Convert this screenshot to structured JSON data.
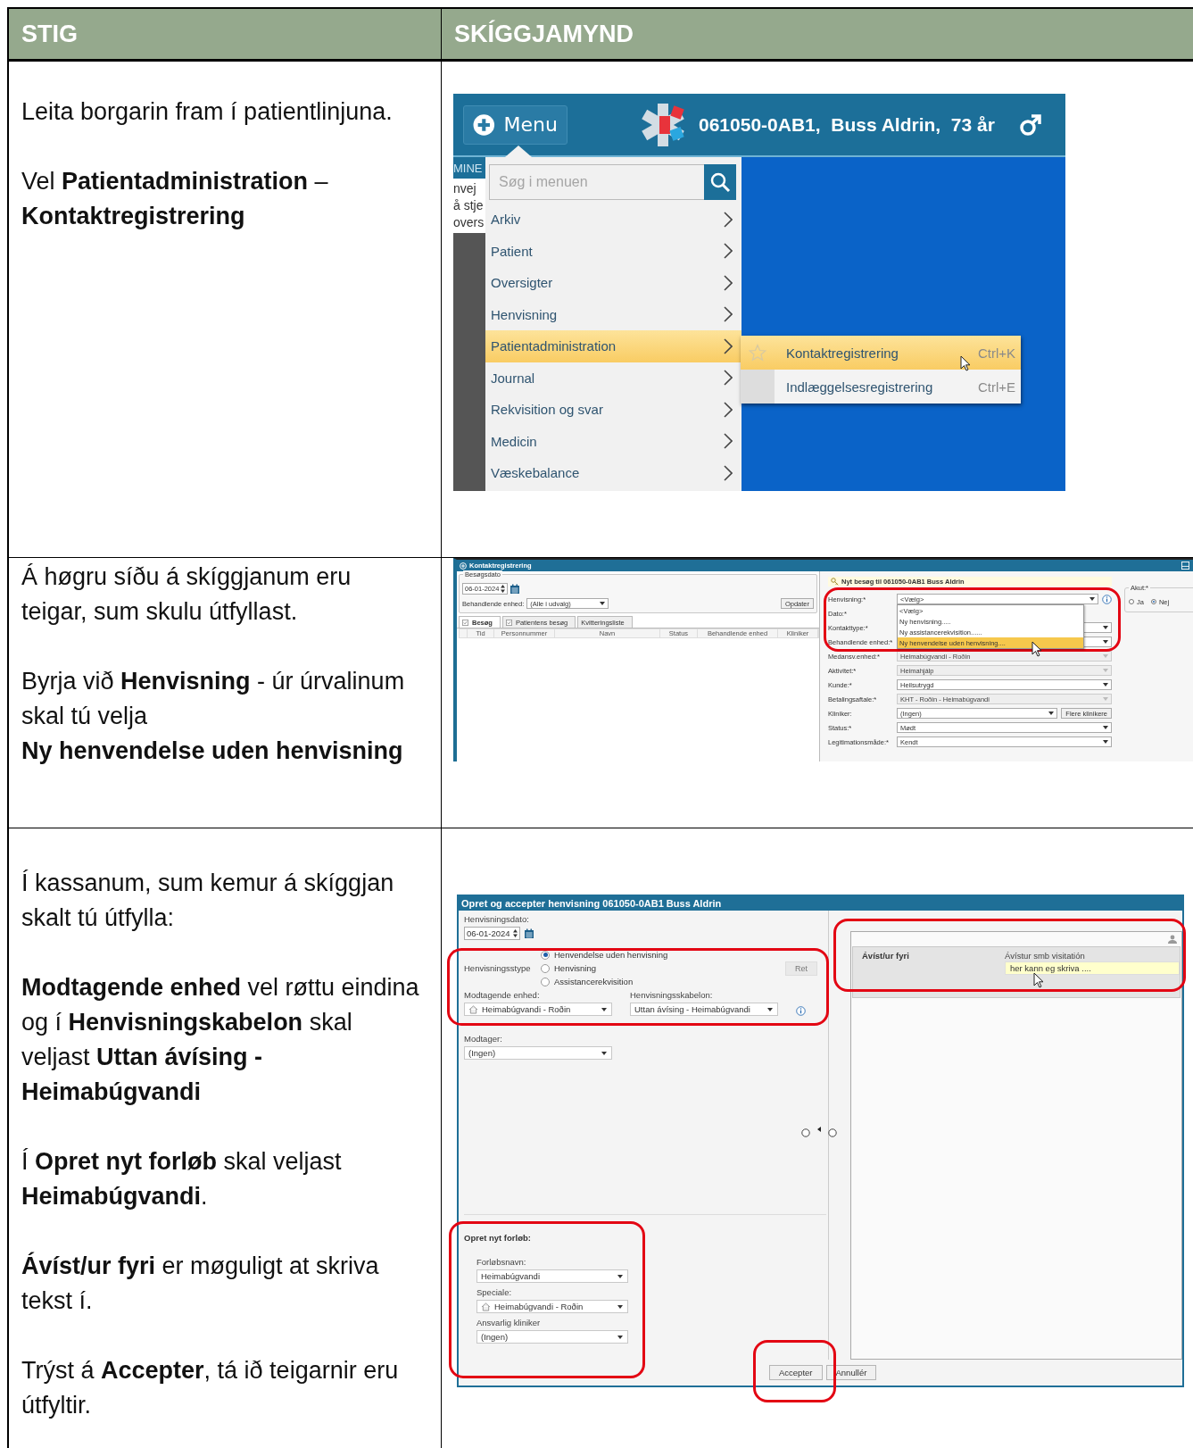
{
  "table": {
    "columns": [
      "STIG",
      "SKÍGGJAMYND"
    ],
    "rows": [
      {
        "text": [
          "Leita borgarin fram í patientlinjuna.",
          "Vel **Patientadministration** – **Kontaktregistrering**"
        ],
        "screenshot": {
          "kind": "menu",
          "menu_button": "Menu",
          "patient": "061050-0AB1,  Buss Aldrin,  73 år",
          "side_tab": "MINE",
          "side_lines": [
            "nvej",
            "å stje",
            "overs"
          ],
          "search": {
            "placeholder": "Søg i menuen"
          },
          "items": [
            {
              "label": "Arkiv",
              "selected": false
            },
            {
              "label": "Patient",
              "selected": false
            },
            {
              "label": "Oversigter",
              "selected": false
            },
            {
              "label": "Henvisning",
              "selected": false
            },
            {
              "label": "Patientadministration",
              "selected": true
            },
            {
              "label": "Journal",
              "selected": false
            },
            {
              "label": "Rekvisition og svar",
              "selected": false
            },
            {
              "label": "Medicin",
              "selected": false
            },
            {
              "label": "Væskebalance",
              "selected": false
            }
          ],
          "submenu": [
            {
              "label": "Kontaktregistrering",
              "shortcut": "Ctrl+K",
              "selected": true
            },
            {
              "label": "Indlæggelsesregistrering",
              "shortcut": "Ctrl+E",
              "selected": false
            }
          ]
        }
      },
      {
        "text": [
          "Á høgru síðu á skíggjanum eru teigar, sum skulu útfyllast.",
          "Byrja við **Henvisning** - úr úrvalinum skal tú velja\n**Ny henvendelse uden henvisning**"
        ],
        "screenshot": {
          "kind": "registration",
          "title": "Kontaktregistrering",
          "visit_date": {
            "legend": "Besøgsdato",
            "value": "06-01-2024"
          },
          "unit": {
            "label": "Behandlende enhed:",
            "value": "(Alle i udvalg)"
          },
          "update_button": "Opdater",
          "tabs": [
            {
              "label": "Besøg",
              "kind": "check",
              "selected": true
            },
            {
              "label": "Patientens besøg",
              "kind": "check",
              "selected": false
            },
            {
              "label": "Kvitteringsliste",
              "kind": "plain",
              "selected": false
            }
          ],
          "columns": [
            "Tid",
            "Personnummer",
            "Navn",
            "Status",
            "Behandlende enhed",
            "Kliniker"
          ],
          "form_title": "Nyt besøg til 061050-0AB1 Buss Aldrin",
          "fields": [
            {
              "kind": "dropdown-info",
              "label": "Henvisning:*",
              "value": "<Vælg>",
              "disabled": false
            },
            {
              "kind": "covered",
              "label": "Dato:*"
            },
            {
              "kind": "covered-dropdown",
              "label": "Kontakttype:*"
            },
            {
              "kind": "covered-dropdown",
              "label": "Behandlende enhed:*"
            },
            {
              "kind": "dropdown",
              "label": "Medansv.enhed:*",
              "value": "Heimabúgvandi - Roðin",
              "disabled": true
            },
            {
              "kind": "dropdown",
              "label": "Aktivitet:*",
              "value": "Heimahjálp",
              "disabled": true
            },
            {
              "kind": "dropdown",
              "label": "Kunde:*",
              "value": "Heilsutrygd",
              "disabled": false
            },
            {
              "kind": "dropdown",
              "label": "Betalingsaftale:*",
              "value": "KHT - Roðin - Heimabúgvandi",
              "disabled": true
            },
            {
              "kind": "dropdown-button",
              "label": "Kliniker:",
              "value": "(Ingen)",
              "disabled": false,
              "button": "Flere klinikere"
            },
            {
              "kind": "dropdown",
              "label": "Status:*",
              "value": "Mødt",
              "disabled": false
            },
            {
              "kind": "dropdown",
              "label": "Legitimationsmåde:*",
              "value": "Kendt",
              "disabled": false
            }
          ],
          "dropdown_options": [
            {
              "label": "<Vælg>",
              "selected": false
            },
            {
              "label": "Ny henvisning.....",
              "selected": false
            },
            {
              "label": "Ny assistancerekvisition......",
              "selected": false
            },
            {
              "label": "Ny henvendelse uden henvisning....",
              "selected": true
            }
          ],
          "akut": {
            "legend": "Akut:*",
            "options": [
              {
                "label": "Ja",
                "selected": false
              },
              {
                "label": "Nej",
                "selected": true
              }
            ]
          }
        }
      },
      {
        "text": [
          "Í kassanum, sum kemur á skíggjan skalt tú útfylla:",
          "**Modtagende enhed** vel røttu eindina og í **Henvisningskabelon** skal veljast **Uttan ávísing - Heimabúgvandi**",
          "Í **Opret nyt forløb** skal veljast **Heimabúgvandi**.",
          "**Ávíst/ur fyri** er møguligt at skriva tekst í.",
          "Trýst á **Accepter**, tá ið teigarnir eru útfyltir."
        ],
        "screenshot": {
          "kind": "referral",
          "title": "Opret og accepter henvisning 061050-0AB1 Buss Aldrin",
          "date": {
            "label": "Henvisningsdato:",
            "value": "06-01-2024"
          },
          "type": {
            "label": "Henvisningsstype",
            "options": [
              {
                "label": "Henvendelse uden henvisning",
                "selected": true
              },
              {
                "label": "Henvisning",
                "selected": false
              },
              {
                "label": "Assistancerekvisition",
                "selected": false
              }
            ]
          },
          "edit_button": {
            "label": "Ret",
            "disabled": true
          },
          "receiving_unit": {
            "label": "Modtagende enhed:",
            "value": "Heimabúgvandi - Roðin",
            "kind": "unit"
          },
          "template": {
            "label": "Henvisningsskabelon:",
            "value": "Uttan ávísing - Heimabúgvandi",
            "kind": "plain"
          },
          "recipient": {
            "label": "Modtager:",
            "value": "(Ingen)",
            "kind": "plain"
          },
          "course": {
            "title": "Opret nyt forløb:",
            "fields": [
              {
                "label": "Forløbsnavn:",
                "value": "Heimabúgvandi",
                "kind": "plain"
              },
              {
                "label": "Speciale:",
                "value": "Heimabúgvandi - Roðin",
                "kind": "unit"
              },
              {
                "label": "Ansvarlig kliniker",
                "value": "(Ingen)",
                "kind": "plain"
              }
            ]
          },
          "referred_for": {
            "label": "Ávíst/ur fyri",
            "field_label": "Ávístur smb visitatión",
            "value": "her kann eg skriva ...."
          },
          "buttons": [
            "Accepter",
            "Annullér"
          ]
        }
      }
    ]
  }
}
